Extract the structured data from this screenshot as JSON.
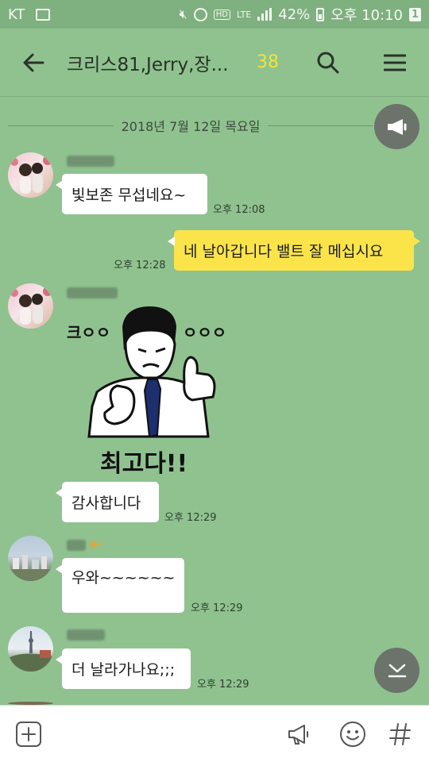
{
  "status_bar": {
    "carrier": "KT",
    "network": "LTE",
    "battery": "42%",
    "time": "오후 10:10",
    "notification_count": "1"
  },
  "header": {
    "title": "크리스81,Jerry,장...",
    "member_count": "38"
  },
  "date_divider": "2018년 7월 12일 목요일",
  "messages": [
    {
      "sender": "",
      "text": "빛보존 무섭네요~",
      "time": "오후 12:08"
    },
    {
      "sender": "me",
      "text": "네 날아갑니다 밸트 잘 메십시요",
      "time": "오후 12:28"
    },
    {
      "sender": "",
      "sticker_text": {
        "left": "크ㅇㅇ",
        "right": "ㅇㅇㅇ",
        "bottom": "최고다!!"
      }
    },
    {
      "sender": "",
      "text": "감사합니다",
      "time": "오후 12:29"
    },
    {
      "sender": "",
      "text": "우와~~~~~~",
      "time": "오후 12:29"
    },
    {
      "sender": "",
      "text": "더 날라가나요;;;",
      "time": "오후 12:29"
    }
  ],
  "colors": {
    "chat_background": "#8fc28f",
    "my_bubble": "#fbe44a",
    "other_bubble": "#ffffff",
    "member_count": "#f2e33b"
  }
}
